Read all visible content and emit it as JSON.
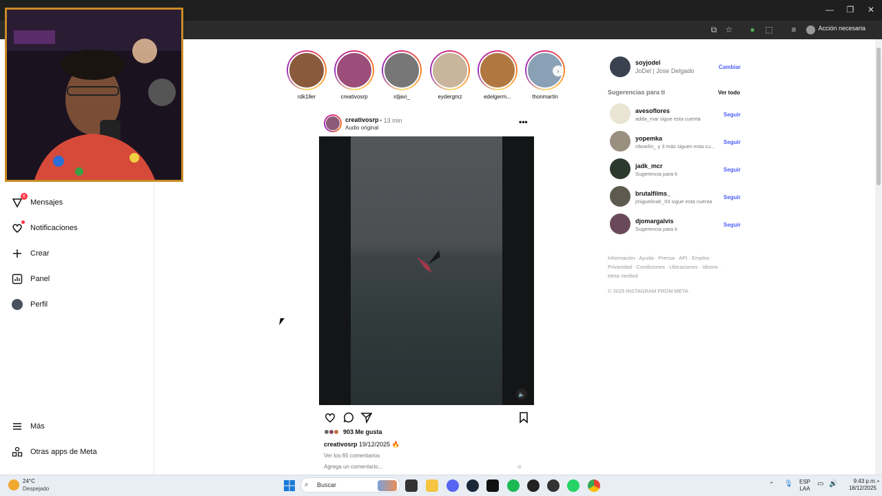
{
  "browser": {
    "action_needed": "Acción necesaria",
    "window_controls": [
      "minimize-icon",
      "restore-icon",
      "close-icon"
    ]
  },
  "left_nav": {
    "items": [
      {
        "label": "Mensajes",
        "icon": "messenger-icon",
        "badge": "6"
      },
      {
        "label": "Notificaciones",
        "icon": "heart-icon",
        "dot": true
      },
      {
        "label": "Crear",
        "icon": "plus-icon"
      },
      {
        "label": "Panel",
        "icon": "chart-icon"
      },
      {
        "label": "Perfil",
        "icon": "avatar"
      },
      {
        "label": "Más",
        "icon": "menu-icon"
      },
      {
        "label": "Otras apps de Meta",
        "icon": "apps-icon"
      }
    ]
  },
  "stories": [
    {
      "name": "rdk1ller",
      "color": "#8a5a3c"
    },
    {
      "name": "creativosrp",
      "color": "#9c4e7a"
    },
    {
      "name": "rdjavi_",
      "color": "#777777"
    },
    {
      "name": "eydergmz",
      "color": "#c8b59c"
    },
    {
      "name": "edelgerm...",
      "color": "#b07840"
    },
    {
      "name": "thonmartin",
      "color": "#8aa0b4"
    }
  ],
  "post": {
    "username": "creativosrp",
    "time": "• 13 min",
    "audio": "Audio original",
    "likes": "903 Me gusta",
    "caption_user": "creativosrp",
    "caption_text": "19/12/2025 🔥",
    "view_comments": "Ver los 65 comentarios",
    "add_comment_placeholder": "Agrega un comentario..."
  },
  "profile": {
    "username": "soyjodel",
    "full_name": "JoDel | Jose Delgado",
    "switch_label": "Cambiar"
  },
  "suggestions": {
    "title": "Sugerencias para ti",
    "see_all": "Ver todo",
    "items": [
      {
        "name": "avesoflores",
        "sub": "adda_mar sigue esta cuenta",
        "follow": "Seguir",
        "color": "#e9e4d4"
      },
      {
        "name": "yopemka",
        "sub": "rdwarlin_ y 3 más siguen esta cu...",
        "follow": "Seguir",
        "color": "#9a9080"
      },
      {
        "name": "jadk_mcr",
        "sub": "Sugerencia para ti",
        "follow": "Seguir",
        "color": "#2c3a2e"
      },
      {
        "name": "brutalfilms_",
        "sub": "jmiguelinalr_03 sigue esta cuenta",
        "follow": "Seguir",
        "color": "#5e5a50"
      },
      {
        "name": "djomargalvis",
        "sub": "Sugerencia para ti",
        "follow": "Seguir",
        "color": "#6a4a5a"
      }
    ]
  },
  "footer": {
    "links": "Información · Ayuda · Prensa · API · Empleo · Privacidad · Condiciones · Ubicaciones · Idioma · Meta Verified",
    "copyright": "© 2025 INSTAGRAM FROM META"
  },
  "taskbar": {
    "weather_temp": "24°C",
    "weather_desc": "Despejado",
    "search_label": "Buscar",
    "lang_line1": "ESP",
    "lang_line2": "LAA",
    "time": "9:43 p.m.",
    "date": "18/12/2025"
  }
}
